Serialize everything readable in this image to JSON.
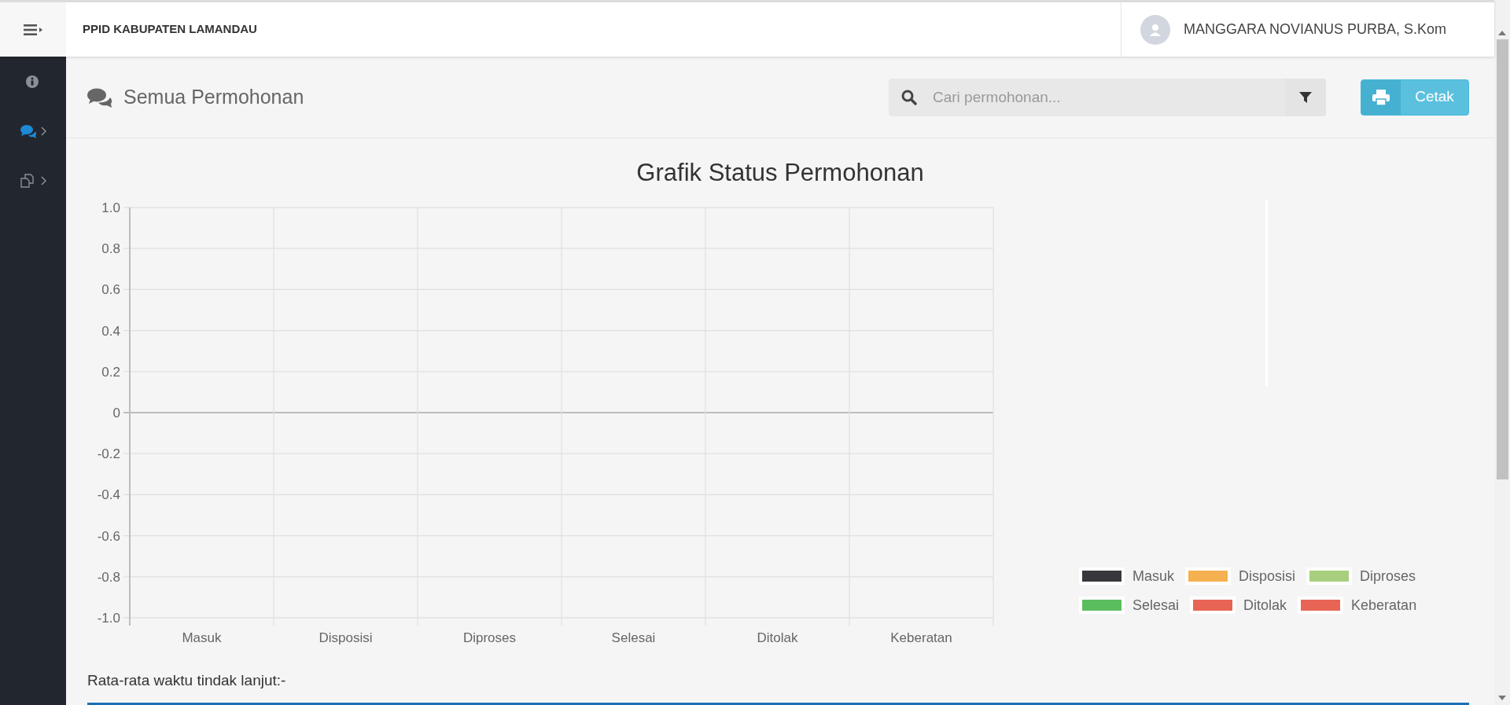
{
  "topbar": {
    "brand": "PPID KABUPATEN LAMANDAU",
    "user_name": "MANGGARA NOVIANUS PURBA, S.Kom"
  },
  "sidebar": {
    "items": [
      {
        "selected": false,
        "has_submenu": false
      },
      {
        "selected": true,
        "has_submenu": true
      },
      {
        "selected": false,
        "has_submenu": true
      }
    ]
  },
  "header": {
    "title": "Semua Permohonan",
    "search": {
      "placeholder": "Cari permohonan..."
    },
    "print_button": "Cetak"
  },
  "chart": {
    "chart_data": {
      "type": "bar",
      "title": "Grafik Status Permohonan",
      "categories": [
        "Masuk",
        "Disposisi",
        "Diproses",
        "Selesai",
        "Ditolak",
        "Keberatan"
      ],
      "ylim": [
        -1,
        1
      ],
      "grid": true,
      "yticks": [
        {
          "value": 1,
          "label": "1.0"
        },
        {
          "value": 0.8,
          "label": "0.8"
        },
        {
          "value": 0.6,
          "label": "0.6"
        },
        {
          "value": 0.4,
          "label": "0.4"
        },
        {
          "value": 0.2,
          "label": "0.2"
        },
        {
          "value": 0,
          "label": "0"
        },
        {
          "value": -0.2,
          "label": "-0.2"
        },
        {
          "value": -0.4,
          "label": "-0.4"
        },
        {
          "value": -0.6,
          "label": "-0.6"
        },
        {
          "value": -0.8,
          "label": "-0.8"
        },
        {
          "value": -1,
          "label": "-1.0"
        }
      ],
      "series": [
        {
          "name": "Masuk",
          "color": "#38373c",
          "values": [
            null,
            null,
            null,
            null,
            null,
            null
          ]
        },
        {
          "name": "Disposisi",
          "color": "#f5b04f",
          "values": [
            null,
            null,
            null,
            null,
            null,
            null
          ]
        },
        {
          "name": "Diproses",
          "color": "#a8cf7e",
          "values": [
            null,
            null,
            null,
            null,
            null,
            null
          ]
        },
        {
          "name": "Selesai",
          "color": "#5cbd5f",
          "values": [
            null,
            null,
            null,
            null,
            null,
            null
          ]
        },
        {
          "name": "Ditolak",
          "color": "#e86454",
          "values": [
            null,
            null,
            null,
            null,
            null,
            null
          ]
        },
        {
          "name": "Keberatan",
          "color": "#e86454",
          "values": [
            null,
            null,
            null,
            null,
            null,
            null
          ]
        }
      ]
    }
  },
  "footer": {
    "average_time_label": "Rata-rata waktu tindak lanjut:-"
  }
}
